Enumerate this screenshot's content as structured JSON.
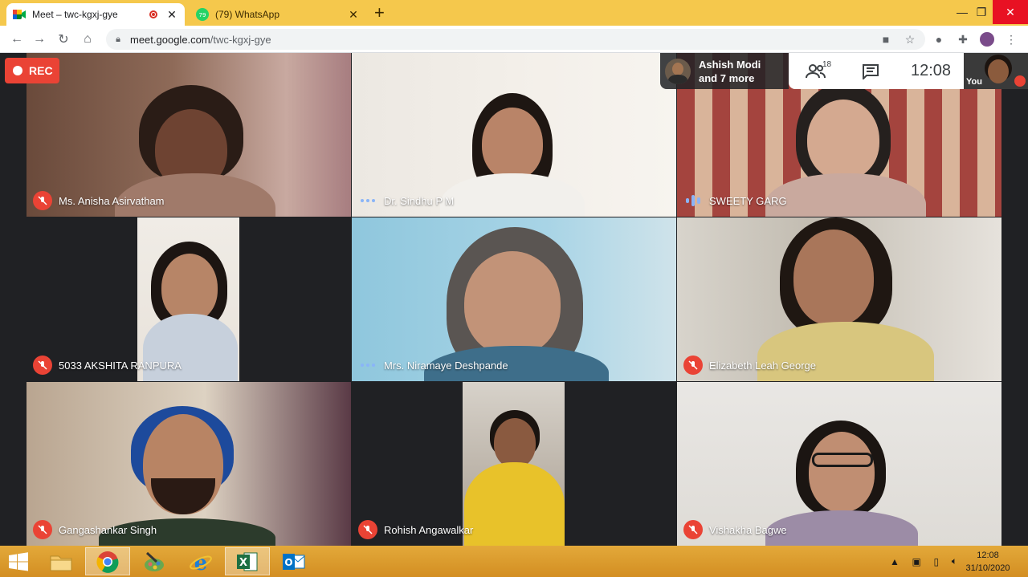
{
  "browser": {
    "tabs": [
      {
        "title": "Meet – twc-kgxj-gye",
        "active": true,
        "recording": true
      },
      {
        "title": "(79) WhatsApp",
        "badge": "79",
        "active": false
      }
    ],
    "url_host": "meet.google.com",
    "url_path": "/twc-kgxj-gye"
  },
  "meet": {
    "rec_label": "REC",
    "others_line1": "Ashish Modi",
    "others_line2": "and 7 more",
    "participants_count": "18",
    "clock": "12:08",
    "self_label": "You",
    "tiles": [
      {
        "name": "Ms. Anisha Asirvatham",
        "status": "muted"
      },
      {
        "name": "Dr. Sindhu P M",
        "status": "idle"
      },
      {
        "name": "SWEETY GARG",
        "status": "speaking"
      },
      {
        "name": "5033 AKSHITA RANPURA",
        "status": "muted"
      },
      {
        "name": "Mrs. Niramaye Deshpande",
        "status": "idle"
      },
      {
        "name": "Elizabeth Leah George",
        "status": "muted"
      },
      {
        "name": "Gangashankar Singh",
        "status": "muted"
      },
      {
        "name": "Rohish Angawalkar",
        "status": "muted"
      },
      {
        "name": "Vishakha Bagwe",
        "status": "muted"
      }
    ]
  },
  "taskbar": {
    "time": "12:08",
    "date": "31/10/2020",
    "apps": [
      "windows-start",
      "file-explorer",
      "chrome",
      "paint",
      "internet-explorer",
      "excel",
      "outlook"
    ]
  },
  "colors": {
    "accent_mute": "#ea4335",
    "speaking": "#8ab4f8",
    "tab_strip": "#f5c84c"
  }
}
